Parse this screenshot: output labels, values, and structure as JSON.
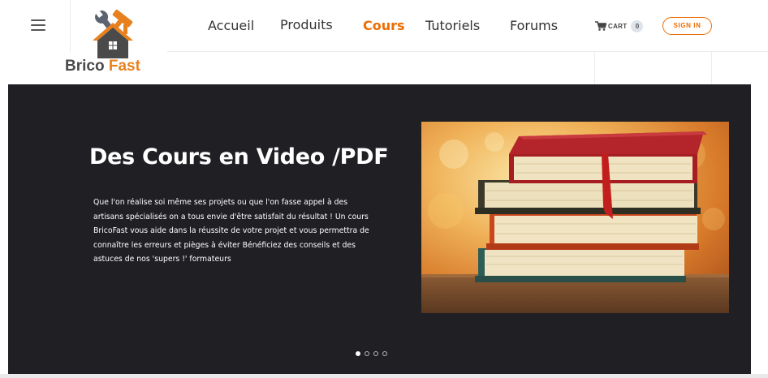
{
  "brand": {
    "name_part1": "Brico",
    "name_part2": "Fast",
    "logo_icon": "house-tools-icon",
    "accent": "#e8801e"
  },
  "header": {
    "menu_icon": "hamburger-icon",
    "nav": [
      {
        "label": "Accueil",
        "active": false
      },
      {
        "label": "Produits",
        "active": false
      },
      {
        "label": "Cours",
        "active": true
      },
      {
        "label": "Tutoriels",
        "active": false
      },
      {
        "label": "Forums",
        "active": false
      }
    ],
    "cart": {
      "label": "CART",
      "count": "0",
      "icon": "cart-icon"
    },
    "signin_label": "SIGN IN"
  },
  "hero": {
    "title": "Des Cours en Video /PDF",
    "text": "Que l'on réalise soi même ses projets ou que l'on fasse appel à des artisans spécialisés on a tous envie d'être satisfait du résultat ! Un cours BricoFast vous aide dans la réussite de votre projet et vous permettra de connaître les erreurs et pièges à éviter Bénéficiez des conseils et des astuces de nos 'supers !' formateurs",
    "image": "stack-of-books-image",
    "slides": 4,
    "active_slide": 1
  },
  "colors": {
    "hero_bg": "#1f1f24",
    "active_nav": "#ef6c00",
    "signin": "#ef6c00"
  }
}
